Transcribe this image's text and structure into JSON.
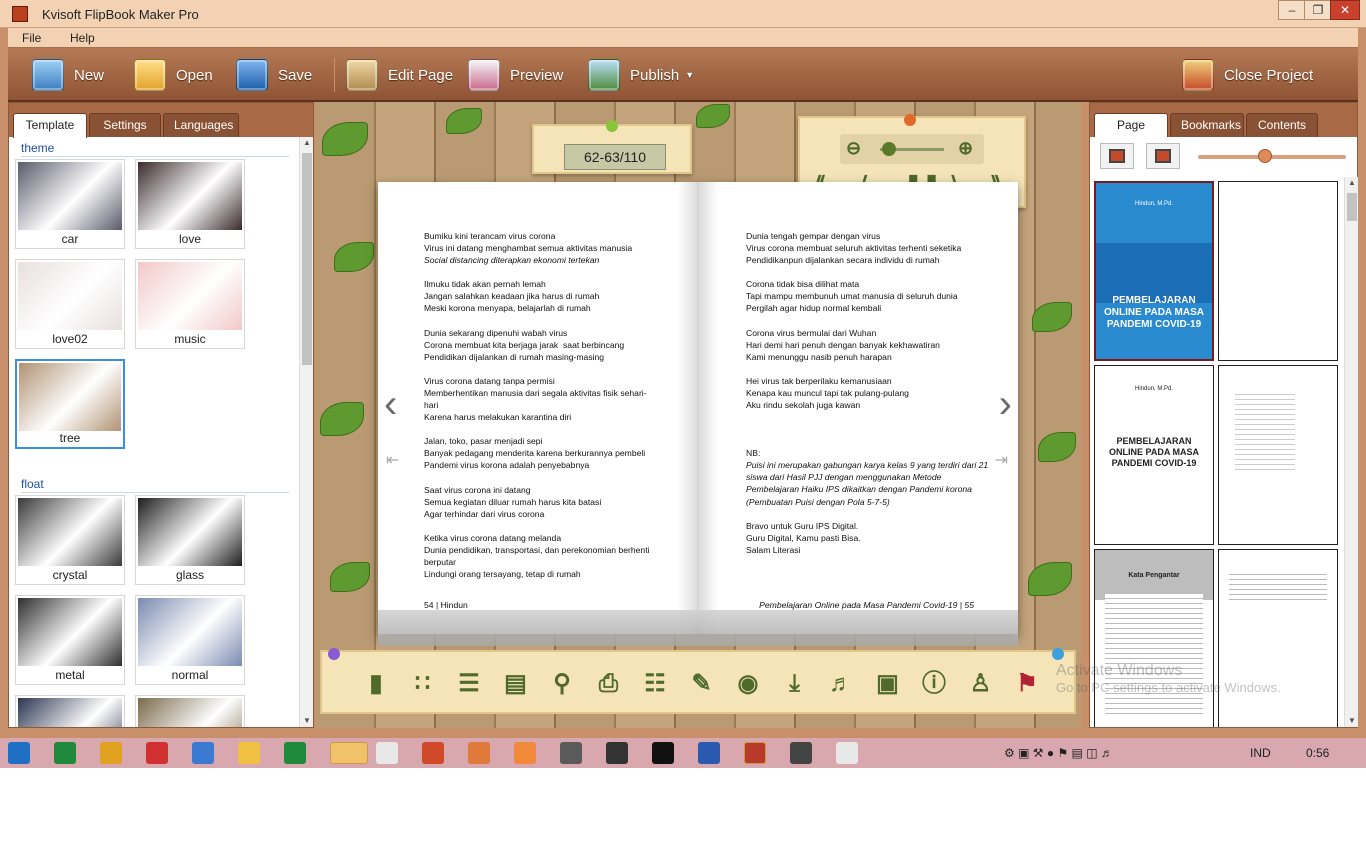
{
  "window": {
    "title": "Kvisoft FlipBook Maker Pro",
    "controls": [
      "minimize",
      "maximize",
      "close"
    ]
  },
  "menu": {
    "file": "File",
    "help": "Help"
  },
  "toolbar": {
    "new": "New",
    "open": "Open",
    "save": "Save",
    "edit_page": "Edit Page",
    "preview": "Preview",
    "publish": "Publish",
    "close_project": "Close Project"
  },
  "left_panel": {
    "tabs": [
      "Template",
      "Settings",
      "Languages"
    ],
    "active_tab": "Template",
    "sections": [
      {
        "name": "theme",
        "templates": [
          {
            "label": "car",
            "color": "#5a5a6a"
          },
          {
            "label": "love",
            "color": "#3a2a2e"
          },
          {
            "label": "love02",
            "color": "#e8e0e0"
          },
          {
            "label": "music",
            "color": "#f2c8c8"
          },
          {
            "label": "tree",
            "color": "#b09272"
          }
        ]
      },
      {
        "name": "float",
        "templates": [
          {
            "label": "crystal",
            "color": "#3a3a3a"
          },
          {
            "label": "glass",
            "color": "#1e1e1e"
          },
          {
            "label": "metal",
            "color": "#2e2e2e"
          },
          {
            "label": "normal",
            "color": "#7a8ab0"
          },
          {
            "label": "",
            "color": "#2a3550"
          },
          {
            "label": "",
            "color": "#7a6a4a"
          }
        ]
      }
    ],
    "selected_template": "tree"
  },
  "viewer": {
    "page_indicator": "62-63/110",
    "left_page": {
      "stanzas": [
        [
          "Bumiku kini terancam virus corona",
          "Virus ini datang menghambat semua aktivitas manusia",
          "Social distancing diterapkan ekonomi tertekan"
        ],
        [
          "Ilmuku tidak akan pernah lemah",
          "Jangan salahkan keadaan jika harus di rumah",
          "Meski korona menyapa, belajarlah di rumah"
        ],
        [
          "Dunia sekarang dipenuhi wabah virus",
          "Corona membuat kita berjaga jarak  saat berbincang",
          "Pendidikan dijalankan di rumah masing-masing"
        ],
        [
          "Virus corona datang tanpa permisi",
          "Memberhentikan manusia dari segala aktivitas fisik sehari-",
          "hari",
          "Karena harus melakukan karantina diri"
        ],
        [
          "Jalan, toko, pasar menjadi sepi",
          "Banyak pedagang menderita karena berkurannya pembeli",
          "Pandemi virus korona adalah penyebabnya"
        ],
        [
          "Saat virus corona ini datang",
          "Semua kegiatan diluar rumah harus kita batasi",
          "Agar terhindar dari virus corona"
        ],
        [
          "Ketika virus corona datang melanda",
          "Dunia pendidikan, transportasi, dan perekonomian berhenti",
          "berputar",
          "Lindungi orang tersayang, tetap di rumah"
        ]
      ],
      "footer": "54 | Hindun"
    },
    "right_page": {
      "stanzas": [
        [
          "Dunia tengah gempar dengan virus",
          "Virus corona membuat seluruh aktivitas terhenti seketika",
          "Pendidikanpun dijalankan secara individu di rumah"
        ],
        [
          "Corona tidak bisa dilihat mata",
          "Tapi mampu membunuh umat manusia di seluruh dunia",
          "Pergilah agar hidup normal kembali"
        ],
        [
          "Corona virus bermulai dari Wuhan",
          "Hari demi hari penuh dengan banyak kekhawatiran",
          "Kami menunggu nasib penuh harapan"
        ],
        [
          "Hei virus tak berperilaku kemanusiaan",
          "Kenapa kau muncul tapi tak pulang-pulang",
          "Aku rindu sekolah juga kawan"
        ]
      ],
      "note_title": "NB:",
      "note_lines": [
        "Puisi ini merupakan gabungan karya kelas 9 yang terdiri dari 21",
        "siswa dari Hasil PJJ dengan menggunakan Metode",
        "Pembelajaran Haiku IPS dikaitkan dengan Pandemi korona",
        "(Pembuatan Puisi dengan Pola 5-7-5)"
      ],
      "closing": [
        "Bravo untuk Guru IPS Digital.",
        "Guru Digital, Kamu pasti Bisa.",
        "Salam Literasi"
      ],
      "footer": "Pembelajaran Online pada Masa Pandemi Covid-19 | 55"
    },
    "bottom_icons": [
      "bookmark-icon",
      "thumbnails-icon",
      "contents-icon",
      "library-icon",
      "search-icon",
      "print-icon",
      "text-icon",
      "annotate-icon",
      "share-icon",
      "download-icon",
      "sound-icon",
      "fullscreen-icon",
      "info-icon",
      "auto-flip-icon",
      "language-flag-icon"
    ],
    "zoom_level": 0.1
  },
  "right_panel": {
    "tabs": [
      "Page",
      "Bookmarks",
      "Contents"
    ],
    "active_tab": "Page",
    "thumb_size": 0.45,
    "pages": [
      {
        "type": "cover",
        "cover_title": "PEMBELAJARAN ONLINE PADA MASA PANDEMI COVID-19",
        "author": "Hindun, M.Pd."
      },
      {
        "type": "blank"
      },
      {
        "type": "title",
        "author": "Hindun, M.Pd.",
        "heading": "PEMBELAJARAN ONLINE PADA MASA PANDEMI COVID-19"
      },
      {
        "type": "text"
      },
      {
        "type": "foreword",
        "heading": "Kata Pengantar"
      },
      {
        "type": "text"
      }
    ]
  },
  "watermark": {
    "line1": "Activate Windows",
    "line2": "Go to PC settings to activate Windows."
  },
  "taskbar": {
    "apps": [
      "start-icon",
      "excel-green-icon",
      "media-icon",
      "record-icon",
      "window-icon",
      "file-icon",
      "excel-icon",
      "explorer-icon",
      "chrome-icon",
      "powerpoint-icon",
      "paint-icon",
      "capture-icon",
      "focus-icon",
      "monitor-icon",
      "camera-icon",
      "word-icon",
      "flipbook-icon",
      "video-icon",
      "chrome2-icon"
    ],
    "language": "IND",
    "time": "0:56"
  }
}
